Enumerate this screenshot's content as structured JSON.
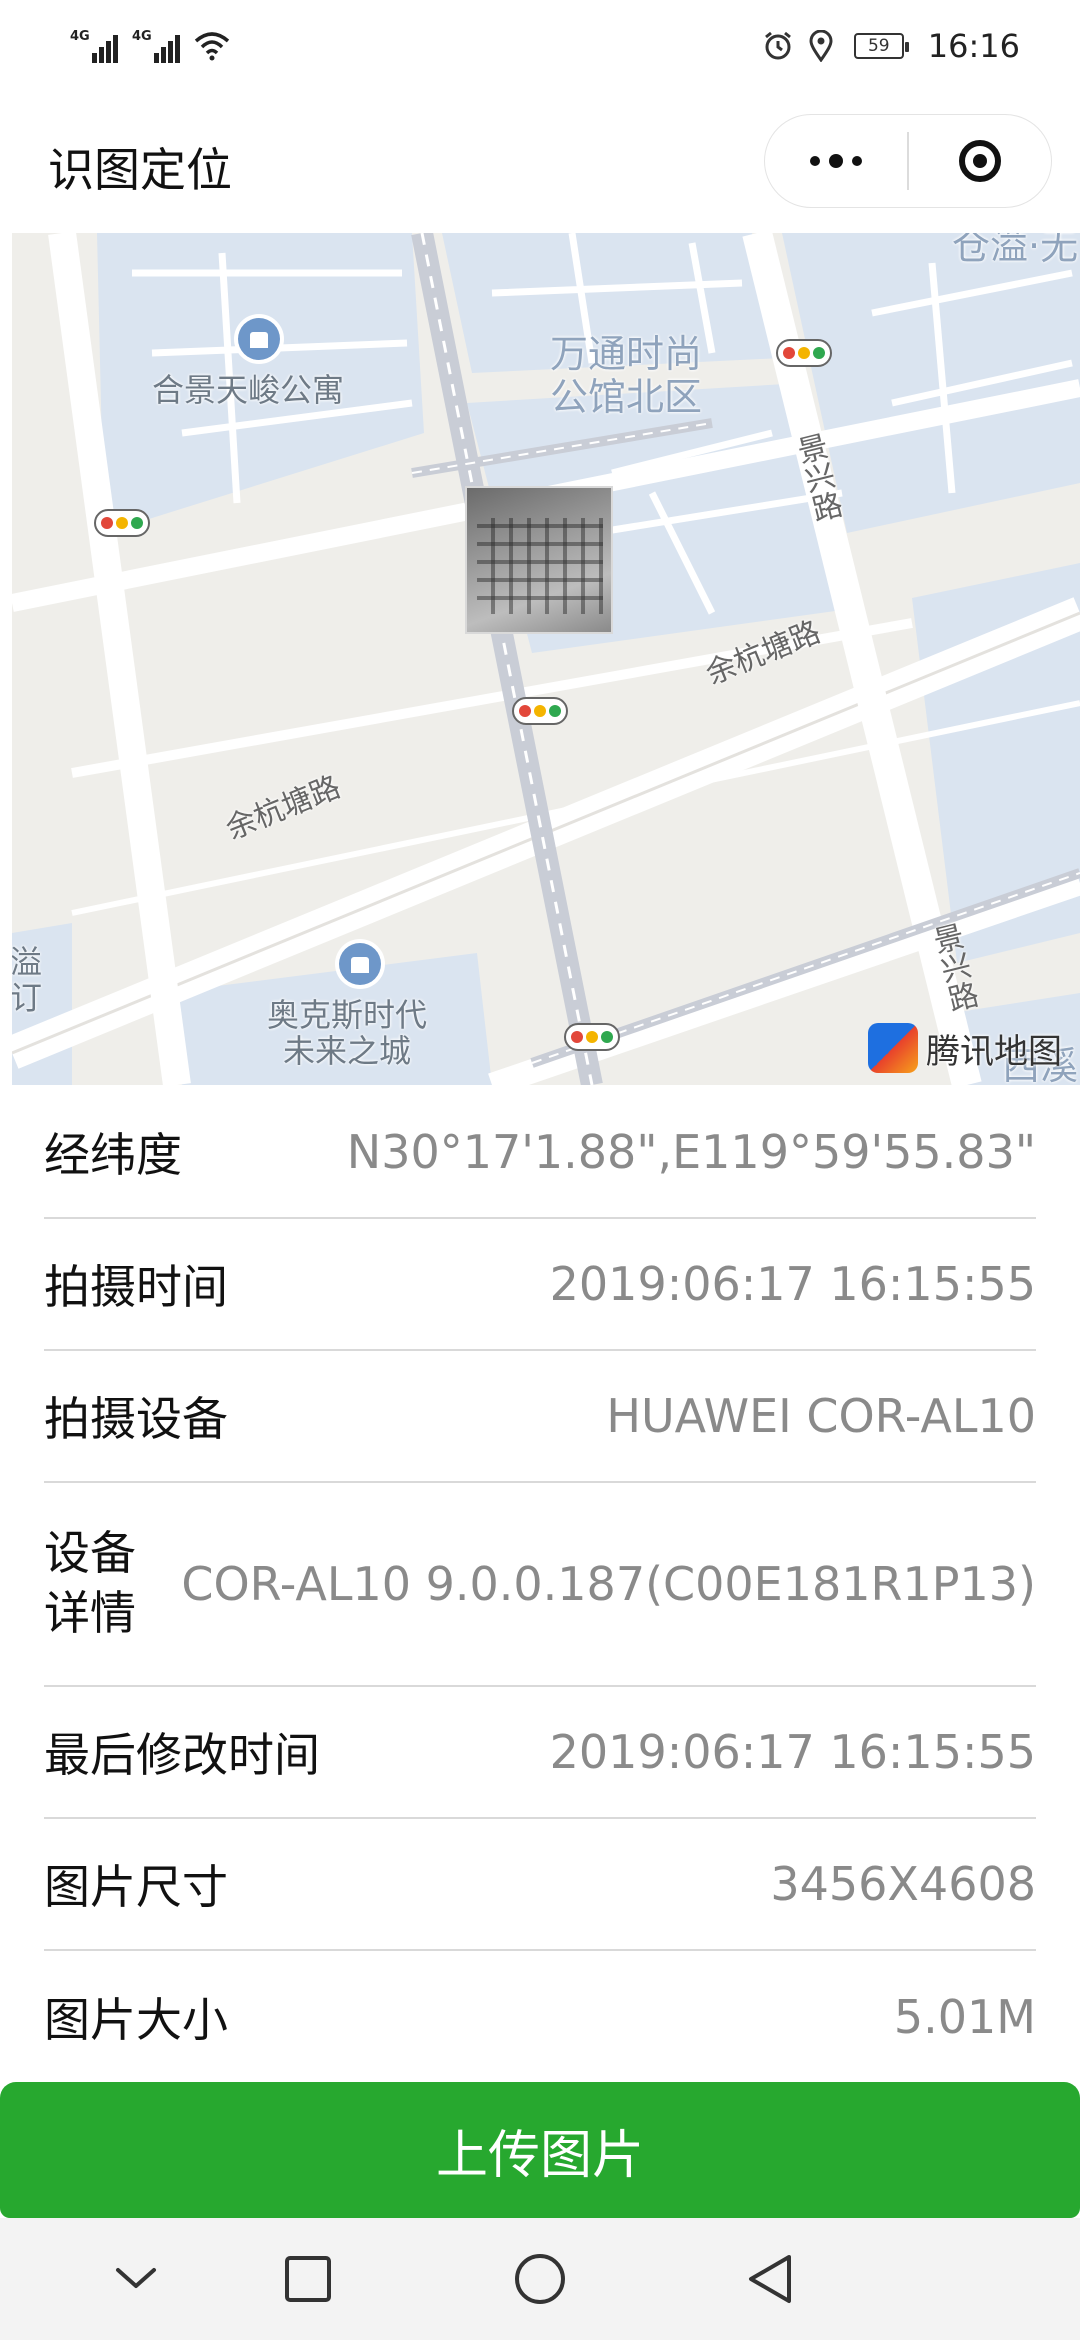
{
  "status_bar": {
    "signal_1": "4G",
    "signal_2": "4G",
    "battery": "59",
    "time": "16:16",
    "icons": [
      "signal-icon",
      "signal-icon",
      "wifi-icon",
      "alarm-icon",
      "location-icon",
      "battery-icon"
    ]
  },
  "nav": {
    "title": "识图定位",
    "more_icon": "more-icon",
    "close_icon": "close-miniprogram-icon"
  },
  "map": {
    "poi_labels": {
      "apartment": "合景天峻公寓",
      "wantong_line1": "万通时尚",
      "wantong_line2": "公馆北区",
      "aokesi_line1": "奥克斯时代",
      "aokesi_line2": "未来之城",
      "top_right": "仓溢·无",
      "left_edge_1": "溢",
      "left_edge_2": "订",
      "bottom_right": "西溪"
    },
    "road_labels": {
      "yuhang_1": "余杭塘路",
      "yuhang_2": "余杭塘路",
      "jingxing_1": "景兴路",
      "jingxing_2": "景兴路"
    },
    "logo": "腾讯地图",
    "colors": {
      "background": "#efeeea",
      "block": "#dae4f0",
      "road": "#ffffff",
      "rail": "#c9cdd6"
    }
  },
  "info": {
    "rows": [
      {
        "label": "经纬度",
        "value": "N30°17'1.88\",E119°59'55.83\""
      },
      {
        "label": "拍摄时间",
        "value": "2019:06:17 16:15:55"
      },
      {
        "label": "拍摄设备",
        "value": "HUAWEI COR-AL10"
      },
      {
        "label": "设备详情",
        "value": "COR-AL10 9.0.0.187(C00E181R1P13)"
      },
      {
        "label": "最后修改时间",
        "value": "2019:06:17 16:15:55"
      },
      {
        "label": "图片尺寸",
        "value": "3456X4608"
      },
      {
        "label": "图片大小",
        "value": "5.01M"
      }
    ]
  },
  "upload_button": "上传图片",
  "brand_color": "#27a82f",
  "system_nav": [
    "chevron-down-icon",
    "square-icon",
    "circle-icon",
    "triangle-back-icon"
  ]
}
